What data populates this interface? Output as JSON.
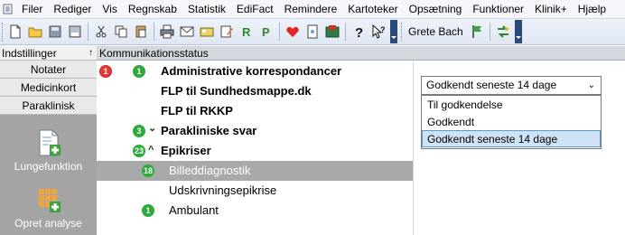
{
  "menubar": {
    "icon": "app-document-icon",
    "items": [
      "Filer",
      "Rediger",
      "Vis",
      "Regnskab",
      "Statistik",
      "EdiFact",
      "Remindere",
      "Kartoteker",
      "Opsætning",
      "Funktioner",
      "Klinik+",
      "Hjælp"
    ]
  },
  "toolbar": {
    "icons": [
      "new-icon",
      "open-folder-icon",
      "disk-icon",
      "save-icon",
      "cut-icon",
      "copy-icon",
      "paste-icon",
      "print-icon",
      "mail-icon",
      "card-icon",
      "edit-icon",
      "r-green-icon",
      "p-green-icon",
      "heart-icon",
      "document-icon",
      "image-icon",
      "help-icon",
      "pointer-help-icon"
    ],
    "user": "Grete Bach",
    "user_icons": [
      "flag-icon",
      "swap-icon"
    ]
  },
  "left_panel": {
    "header": "Indstillinger",
    "pin": "↑",
    "tabs": [
      "Notater",
      "Medicinkort",
      "Paraklinisk"
    ],
    "tools": [
      {
        "label": "Lungefunktion",
        "icon": "lung-function-icon"
      },
      {
        "label": "Opret analyse",
        "icon": "create-analysis-icon"
      }
    ]
  },
  "main": {
    "title": "Kommunikationsstatus",
    "rows": [
      {
        "label": "Administrative korrespondancer",
        "bold": true,
        "red_badge": "1",
        "green_badge": "1"
      },
      {
        "label": "FLP til Sundhedsmappe.dk",
        "bold": true
      },
      {
        "label": "FLP til RKKP",
        "bold": true
      },
      {
        "label": "Parakliniske svar",
        "bold": true,
        "green_badge": "3",
        "chevron": "⌄"
      },
      {
        "label": "Epikriser",
        "bold": true,
        "green_badge": "23",
        "chevron": "^"
      },
      {
        "label": "Billeddiagnostik",
        "bold": false,
        "green_badge": "18",
        "selected": true
      },
      {
        "label": "Udskrivningsepikrise",
        "bold": false
      },
      {
        "label": "Ambulant",
        "bold": false,
        "green_badge": "1"
      }
    ]
  },
  "filter": {
    "selected": "Godkendt seneste 14 dage",
    "arrow": "⌄",
    "options": [
      "Til godkendelse",
      "Godkendt",
      "Godkendt seneste 14 dage"
    ]
  }
}
